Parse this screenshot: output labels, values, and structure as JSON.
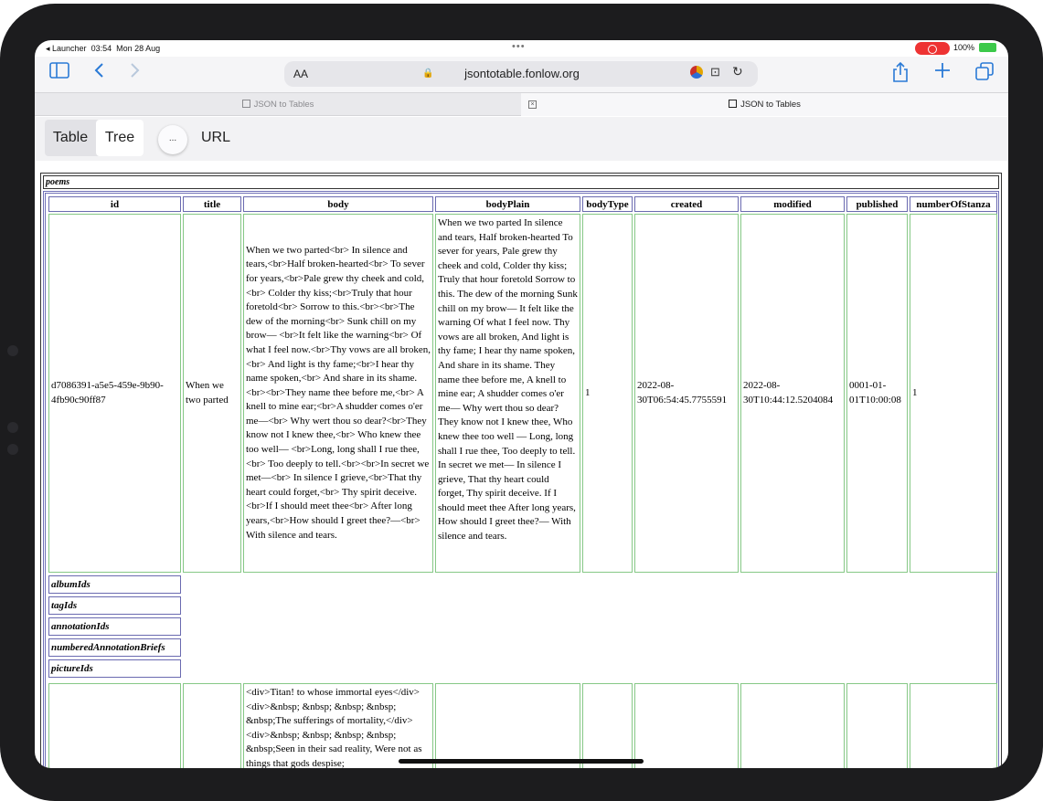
{
  "status": {
    "back_app": "◂ Launcher",
    "time": "03:54",
    "date": "Mon 28 Aug",
    "dots": "•••",
    "battery": "100%"
  },
  "browser": {
    "text_size_label": "AA",
    "url": "jsontotable.fonlow.org",
    "tabs": [
      {
        "title": "JSON to Tables",
        "active": false
      },
      {
        "title": "JSON to Tables",
        "active": true
      }
    ]
  },
  "app": {
    "table_label": "Table",
    "tree_label": "Tree",
    "more_label": "...",
    "url_label": "URL"
  },
  "table": {
    "caption": "poems",
    "headers": [
      "id",
      "title",
      "body",
      "bodyPlain",
      "bodyType",
      "created",
      "modified",
      "published",
      "numberOfStanza"
    ],
    "row1": {
      "id": "d7086391-a5e5-459e-9b90-4fb90c90ff87",
      "title": "When we two parted",
      "body": "When we two parted<br> In silence and tears,<br>Half broken-hearted<br> To sever for years,<br>Pale grew thy cheek and cold,<br> Colder thy kiss;<br>Truly that hour foretold<br> Sorrow to this.<br><br>The dew of the morning<br> Sunk chill on my brow— <br>It felt like the warning<br> Of what I feel now.<br>Thy vows are all broken,<br> And light is thy fame;<br>I hear thy name spoken,<br> And share in its shame.<br><br>They name thee before me,<br> A knell to mine ear;<br>A shudder comes o'er me—<br> Why wert thou so dear?<br>They know not I knew thee,<br> Who knew thee too well— <br>Long, long shall I rue thee,<br> Too deeply to tell.<br><br>In secret we met—<br> In silence I grieve,<br>That thy heart could forget,<br> Thy spirit deceive.<br>If I should meet thee<br> After long years,<br>How should I greet thee?—<br> With silence and tears.",
      "bodyPlain": "When we two parted In silence and tears, Half broken-hearted To sever for years, Pale grew thy cheek and cold, Colder thy kiss; Truly that hour foretold Sorrow to this. The dew of the morning Sunk chill on my brow— It felt like the warning Of what I feel now. Thy vows are all broken, And light is thy fame; I hear thy name spoken, And share in its shame. They name thee before me, A knell to mine ear; A shudder comes o'er me— Why wert thou so dear? They know not I knew thee, Who knew thee too well — Long, long shall I rue thee, Too deeply to tell. In secret we met— In silence I grieve, That thy heart could forget, Thy spirit deceive. If I should meet thee After long years, How should I greet thee?— With silence and tears.",
      "bodyType": "1",
      "created": "2022-08-30T06:54:45.7755591",
      "modified": "2022-08-30T10:44:12.5204084",
      "published": "0001-01-01T10:00:08",
      "numberOfStanza": "1"
    },
    "sub_tables": [
      "albumIds",
      "tagIds",
      "annotationIds",
      "numberedAnnotationBriefs",
      "pictureIds"
    ],
    "row2": {
      "body": "<div>Titan! to whose immortal eyes</div><div>&nbsp; &nbsp; &nbsp; &nbsp; &nbsp;The sufferings of mortality,</div><div>&nbsp; &nbsp; &nbsp; &nbsp; &nbsp;Seen in their sad reality, Were not as things that gods despise;"
    }
  }
}
